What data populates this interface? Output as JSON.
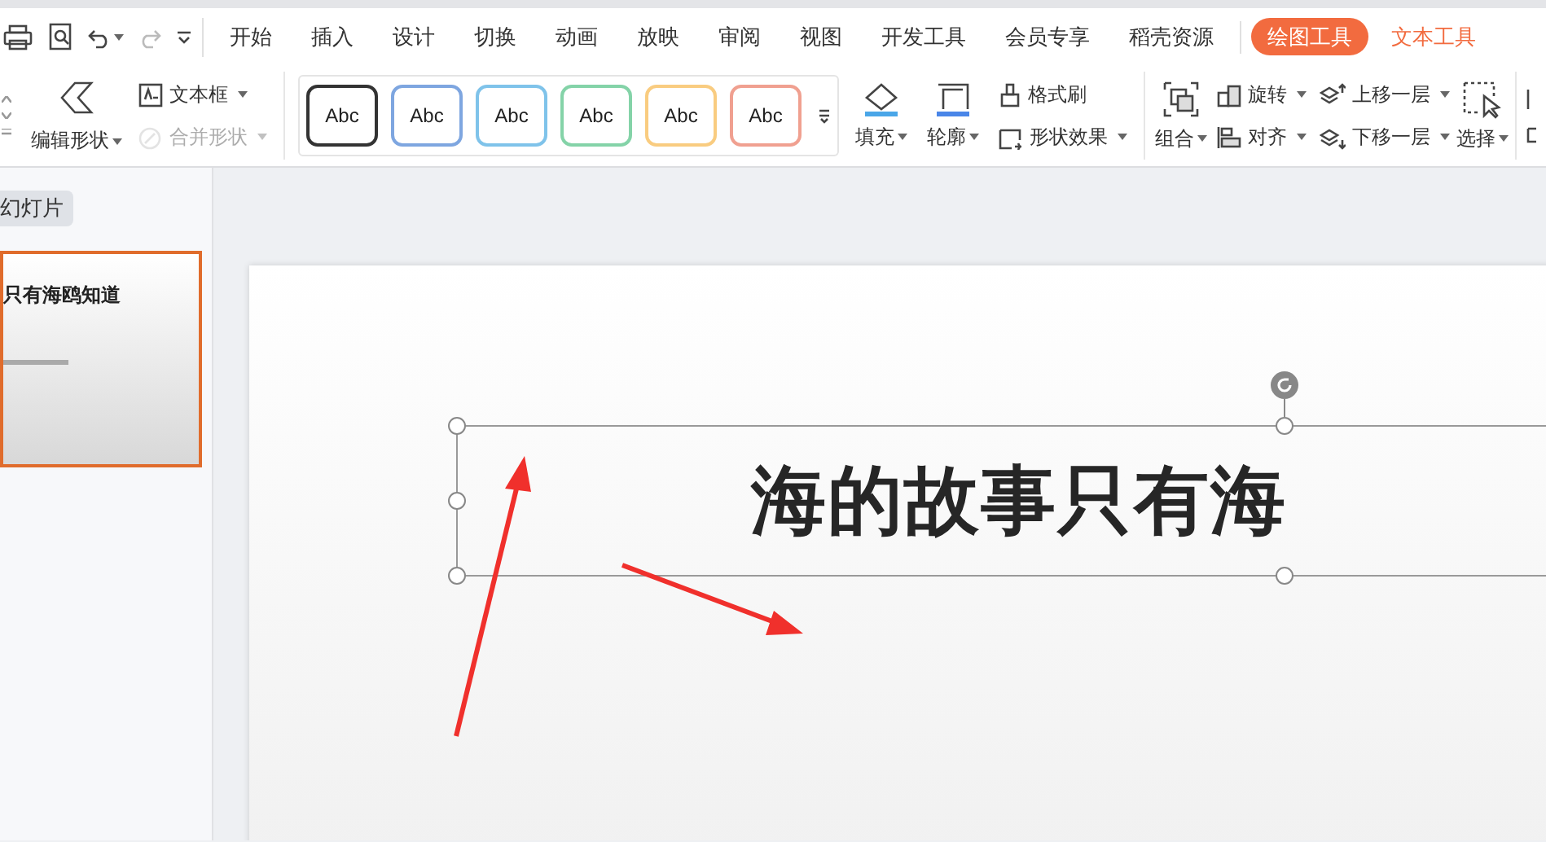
{
  "tabs": [
    {
      "label": "开始",
      "kind": "main",
      "selected": false
    },
    {
      "label": "插入",
      "kind": "main",
      "selected": false
    },
    {
      "label": "设计",
      "kind": "main",
      "selected": false
    },
    {
      "label": "切换",
      "kind": "main",
      "selected": false
    },
    {
      "label": "动画",
      "kind": "main",
      "selected": false
    },
    {
      "label": "放映",
      "kind": "main",
      "selected": false
    },
    {
      "label": "审阅",
      "kind": "main",
      "selected": false
    },
    {
      "label": "视图",
      "kind": "main",
      "selected": false
    },
    {
      "label": "开发工具",
      "kind": "main",
      "selected": false
    },
    {
      "label": "会员专享",
      "kind": "main",
      "selected": false
    },
    {
      "label": "稻壳资源",
      "kind": "main",
      "selected": false
    },
    {
      "label": "绘图工具",
      "kind": "context",
      "selected": true
    },
    {
      "label": "文本工具",
      "kind": "context",
      "selected": false
    }
  ],
  "ribbon": {
    "edit_shape": "编辑形状",
    "text_box": "文本框",
    "merge_shapes": {
      "label": "合并形状",
      "disabled": true
    },
    "styles": [
      {
        "label": "Abc",
        "color": "#333333"
      },
      {
        "label": "Abc",
        "color": "#7ea6e0"
      },
      {
        "label": "Abc",
        "color": "#7fc3ea"
      },
      {
        "label": "Abc",
        "color": "#84d3a8"
      },
      {
        "label": "Abc",
        "color": "#f9cc80"
      },
      {
        "label": "Abc",
        "color": "#f0a090"
      }
    ],
    "fill": "填充",
    "outline": "轮廓",
    "format_painter": "格式刷",
    "shape_effects": "形状效果",
    "group": "组合",
    "rotate": "旋转",
    "align": "对齐",
    "bring_forward": "上移一层",
    "send_backward": "下移一层",
    "select": "选择"
  },
  "slide_panel": {
    "tab": "幻灯片",
    "thumbnails": [
      {
        "title": "只有海鸥知道",
        "selected": true
      }
    ]
  },
  "slide": {
    "title": "海的故事只有海"
  }
}
